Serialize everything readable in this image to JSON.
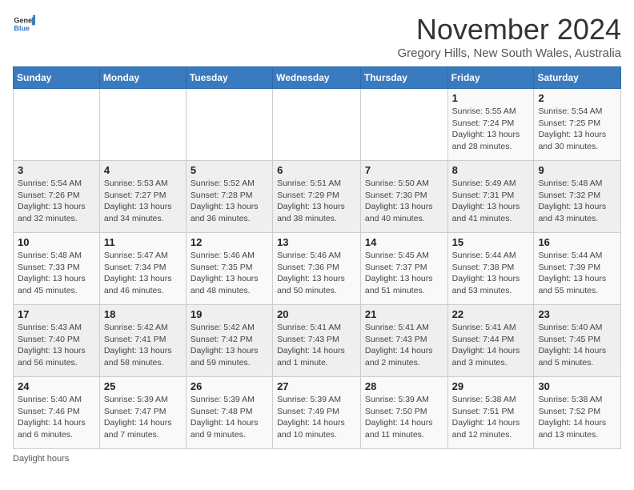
{
  "header": {
    "logo_general": "General",
    "logo_blue": "Blue",
    "month_title": "November 2024",
    "location": "Gregory Hills, New South Wales, Australia"
  },
  "weekdays": [
    "Sunday",
    "Monday",
    "Tuesday",
    "Wednesday",
    "Thursday",
    "Friday",
    "Saturday"
  ],
  "footer": {
    "daylight_hours": "Daylight hours"
  },
  "weeks": [
    [
      {
        "day": "",
        "info": ""
      },
      {
        "day": "",
        "info": ""
      },
      {
        "day": "",
        "info": ""
      },
      {
        "day": "",
        "info": ""
      },
      {
        "day": "",
        "info": ""
      },
      {
        "day": "1",
        "info": "Sunrise: 5:55 AM\nSunset: 7:24 PM\nDaylight: 13 hours and 28 minutes."
      },
      {
        "day": "2",
        "info": "Sunrise: 5:54 AM\nSunset: 7:25 PM\nDaylight: 13 hours and 30 minutes."
      }
    ],
    [
      {
        "day": "3",
        "info": "Sunrise: 5:54 AM\nSunset: 7:26 PM\nDaylight: 13 hours and 32 minutes."
      },
      {
        "day": "4",
        "info": "Sunrise: 5:53 AM\nSunset: 7:27 PM\nDaylight: 13 hours and 34 minutes."
      },
      {
        "day": "5",
        "info": "Sunrise: 5:52 AM\nSunset: 7:28 PM\nDaylight: 13 hours and 36 minutes."
      },
      {
        "day": "6",
        "info": "Sunrise: 5:51 AM\nSunset: 7:29 PM\nDaylight: 13 hours and 38 minutes."
      },
      {
        "day": "7",
        "info": "Sunrise: 5:50 AM\nSunset: 7:30 PM\nDaylight: 13 hours and 40 minutes."
      },
      {
        "day": "8",
        "info": "Sunrise: 5:49 AM\nSunset: 7:31 PM\nDaylight: 13 hours and 41 minutes."
      },
      {
        "day": "9",
        "info": "Sunrise: 5:48 AM\nSunset: 7:32 PM\nDaylight: 13 hours and 43 minutes."
      }
    ],
    [
      {
        "day": "10",
        "info": "Sunrise: 5:48 AM\nSunset: 7:33 PM\nDaylight: 13 hours and 45 minutes."
      },
      {
        "day": "11",
        "info": "Sunrise: 5:47 AM\nSunset: 7:34 PM\nDaylight: 13 hours and 46 minutes."
      },
      {
        "day": "12",
        "info": "Sunrise: 5:46 AM\nSunset: 7:35 PM\nDaylight: 13 hours and 48 minutes."
      },
      {
        "day": "13",
        "info": "Sunrise: 5:46 AM\nSunset: 7:36 PM\nDaylight: 13 hours and 50 minutes."
      },
      {
        "day": "14",
        "info": "Sunrise: 5:45 AM\nSunset: 7:37 PM\nDaylight: 13 hours and 51 minutes."
      },
      {
        "day": "15",
        "info": "Sunrise: 5:44 AM\nSunset: 7:38 PM\nDaylight: 13 hours and 53 minutes."
      },
      {
        "day": "16",
        "info": "Sunrise: 5:44 AM\nSunset: 7:39 PM\nDaylight: 13 hours and 55 minutes."
      }
    ],
    [
      {
        "day": "17",
        "info": "Sunrise: 5:43 AM\nSunset: 7:40 PM\nDaylight: 13 hours and 56 minutes."
      },
      {
        "day": "18",
        "info": "Sunrise: 5:42 AM\nSunset: 7:41 PM\nDaylight: 13 hours and 58 minutes."
      },
      {
        "day": "19",
        "info": "Sunrise: 5:42 AM\nSunset: 7:42 PM\nDaylight: 13 hours and 59 minutes."
      },
      {
        "day": "20",
        "info": "Sunrise: 5:41 AM\nSunset: 7:43 PM\nDaylight: 14 hours and 1 minute."
      },
      {
        "day": "21",
        "info": "Sunrise: 5:41 AM\nSunset: 7:43 PM\nDaylight: 14 hours and 2 minutes."
      },
      {
        "day": "22",
        "info": "Sunrise: 5:41 AM\nSunset: 7:44 PM\nDaylight: 14 hours and 3 minutes."
      },
      {
        "day": "23",
        "info": "Sunrise: 5:40 AM\nSunset: 7:45 PM\nDaylight: 14 hours and 5 minutes."
      }
    ],
    [
      {
        "day": "24",
        "info": "Sunrise: 5:40 AM\nSunset: 7:46 PM\nDaylight: 14 hours and 6 minutes."
      },
      {
        "day": "25",
        "info": "Sunrise: 5:39 AM\nSunset: 7:47 PM\nDaylight: 14 hours and 7 minutes."
      },
      {
        "day": "26",
        "info": "Sunrise: 5:39 AM\nSunset: 7:48 PM\nDaylight: 14 hours and 9 minutes."
      },
      {
        "day": "27",
        "info": "Sunrise: 5:39 AM\nSunset: 7:49 PM\nDaylight: 14 hours and 10 minutes."
      },
      {
        "day": "28",
        "info": "Sunrise: 5:39 AM\nSunset: 7:50 PM\nDaylight: 14 hours and 11 minutes."
      },
      {
        "day": "29",
        "info": "Sunrise: 5:38 AM\nSunset: 7:51 PM\nDaylight: 14 hours and 12 minutes."
      },
      {
        "day": "30",
        "info": "Sunrise: 5:38 AM\nSunset: 7:52 PM\nDaylight: 14 hours and 13 minutes."
      }
    ]
  ]
}
